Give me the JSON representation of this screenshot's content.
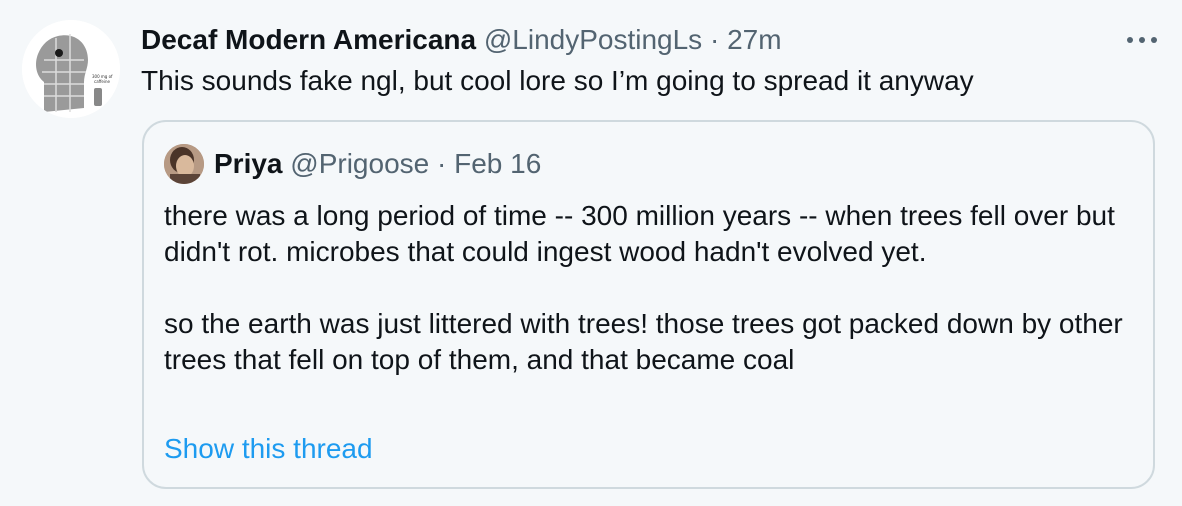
{
  "tweet": {
    "author_name": "Decaf Modern Americana",
    "handle": "@LindyPostingLs",
    "separator": "·",
    "time": "27m",
    "text": "This sounds fake ngl, but cool lore so I’m going to spread it anyway",
    "avatar_caption": "300 mg of caffeine"
  },
  "quoted": {
    "author_name": "Priya",
    "handle": "@Prigoose",
    "separator": "·",
    "date": "Feb 16",
    "paragraphs": [
      "there was a long period of time -- 300 million years -- when trees fell over but didn't rot. microbes that could ingest wood hadn't evolved yet.",
      "so the earth was just littered with trees! those trees got packed down by other trees that fell on top of them, and that became coal"
    ],
    "show_thread": "Show this thread"
  },
  "icons": {
    "more": "more-icon"
  },
  "colors": {
    "background": "#f5f8fa",
    "text": "#0f1419",
    "muted": "#536471",
    "link": "#1d9bf0",
    "border": "#cfd9de"
  }
}
